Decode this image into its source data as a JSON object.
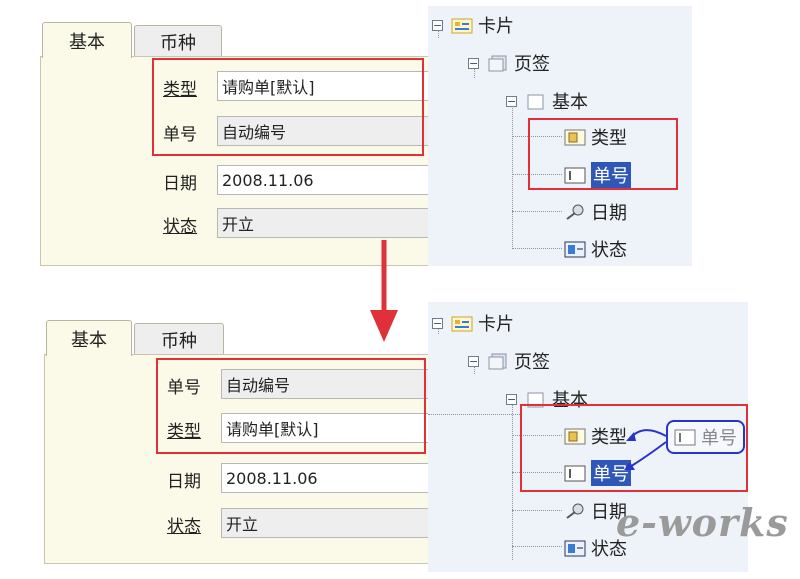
{
  "top": {
    "tabs": [
      {
        "label": "基本"
      },
      {
        "label": "币种"
      }
    ],
    "fields": [
      {
        "label": "类型",
        "value": "请购单[默认]"
      },
      {
        "label": "单号",
        "value": "自动编号"
      },
      {
        "label": "日期",
        "value": "2008.11.06"
      },
      {
        "label": "状态",
        "value": "开立"
      }
    ],
    "tree": {
      "card": "卡片",
      "page": "页签",
      "basic": "基本",
      "items": [
        {
          "label": "类型"
        },
        {
          "label": "单号"
        },
        {
          "label": "日期"
        },
        {
          "label": "状态"
        }
      ]
    }
  },
  "bottom": {
    "tabs": [
      {
        "label": "基本"
      },
      {
        "label": "币种"
      }
    ],
    "fields": [
      {
        "label": "单号",
        "value": "自动编号"
      },
      {
        "label": "类型",
        "value": "请购单[默认]"
      },
      {
        "label": "日期",
        "value": "2008.11.06"
      },
      {
        "label": "状态",
        "value": "开立"
      }
    ],
    "tree": {
      "card": "卡片",
      "page": "页签",
      "basic": "基本",
      "items": [
        {
          "label": "类型"
        },
        {
          "label": "单号"
        },
        {
          "label": "日期"
        },
        {
          "label": "状态"
        }
      ],
      "drag_ghost": "单号"
    }
  },
  "watermark": "e-works",
  "colors": {
    "highlight_box": "#e0303a",
    "arrow": "#e0303a",
    "drag_ghost": "#2a34c8",
    "selection": "#2f57b8"
  },
  "icons": [
    "expand-minus-icon",
    "card-icon",
    "page-icon",
    "folder-icon",
    "combo-field-icon",
    "text-field-icon",
    "date-field-icon",
    "status-field-icon",
    "down-arrow-icon"
  ]
}
